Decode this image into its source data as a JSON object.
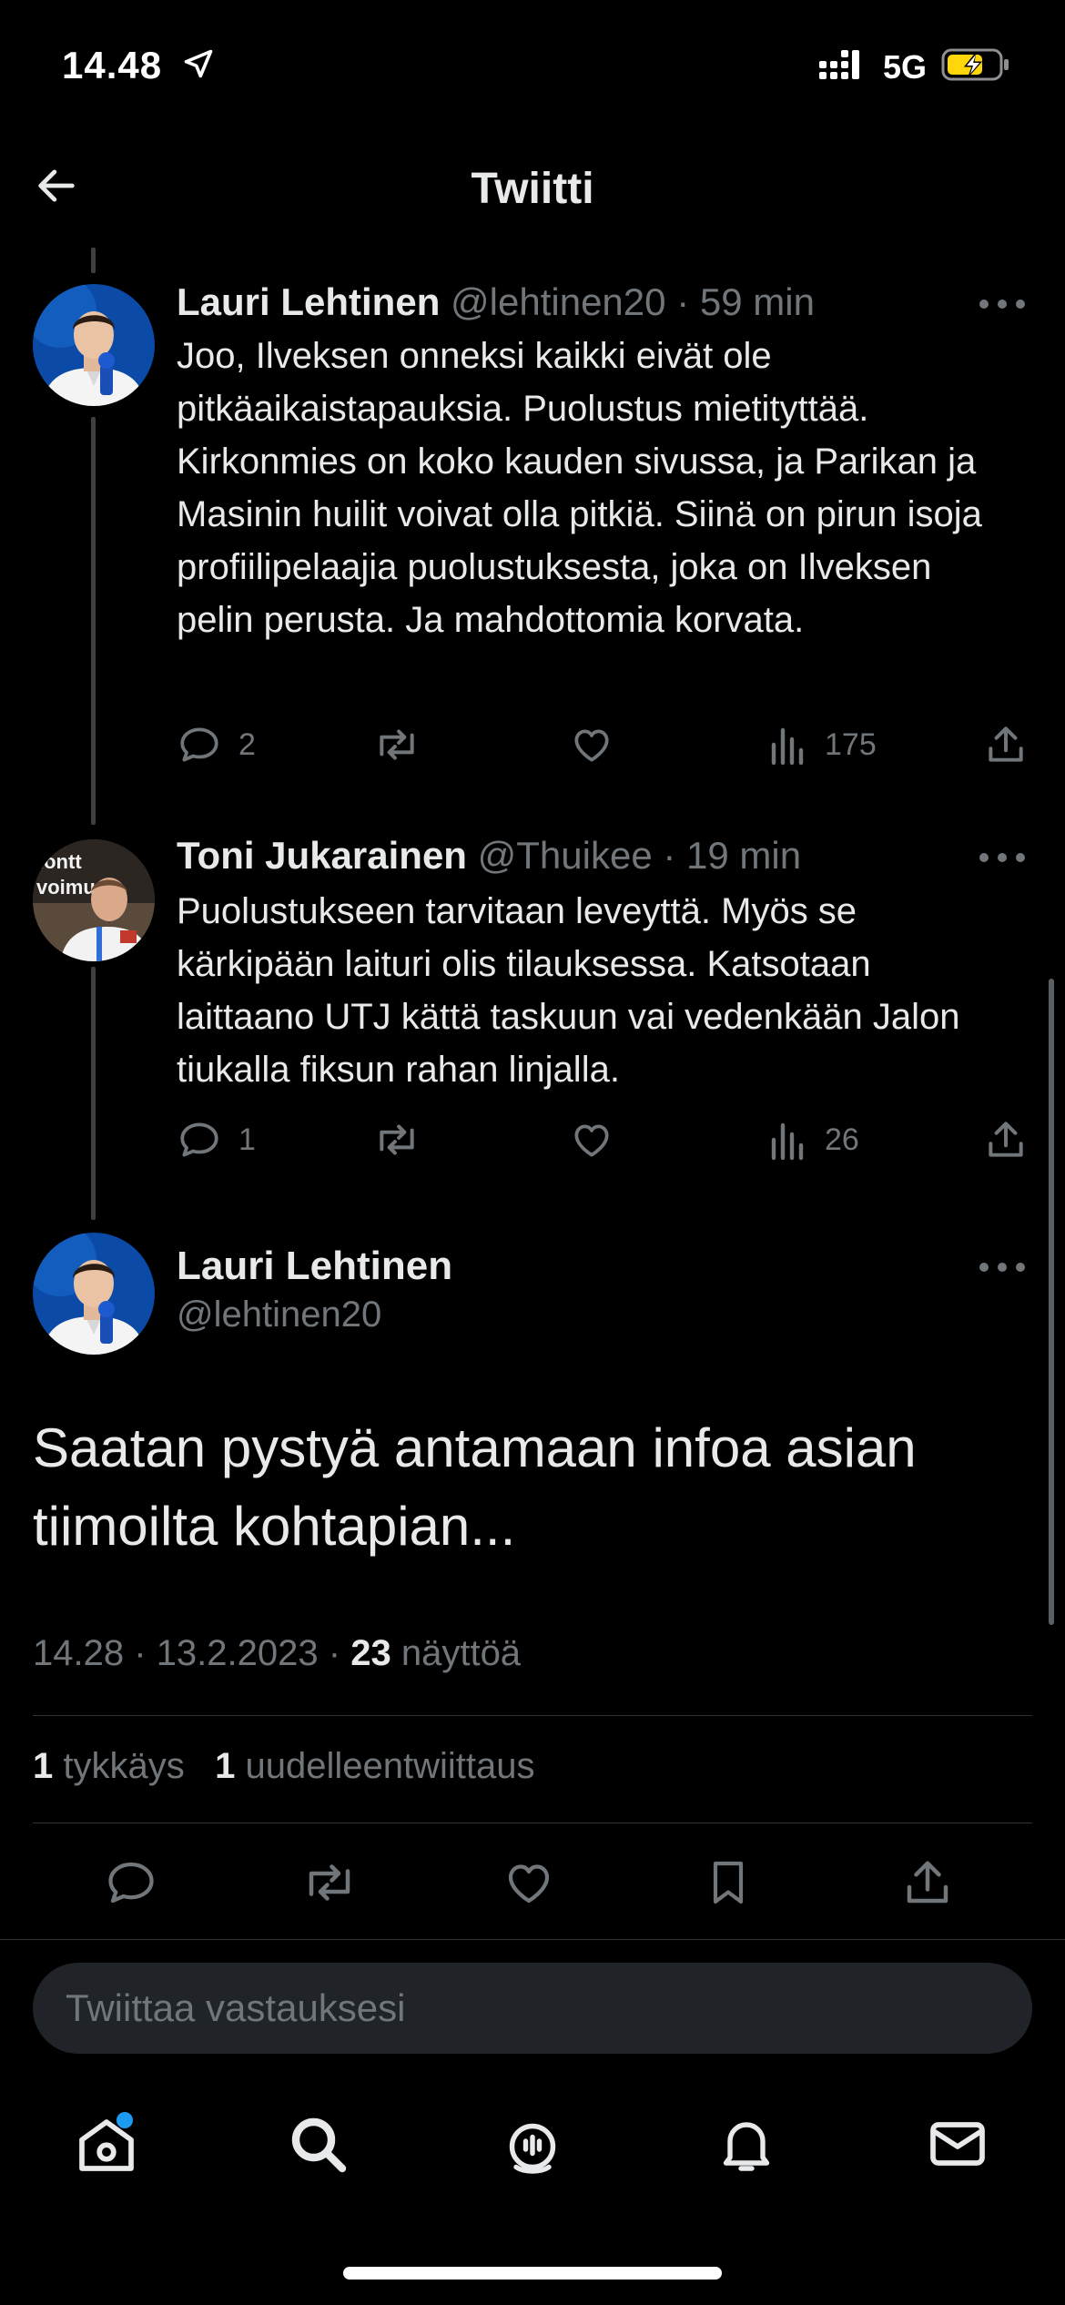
{
  "status_bar": {
    "time": "14.48",
    "network": "5G"
  },
  "nav": {
    "title": "Twiitti"
  },
  "replies": [
    {
      "name": "Lauri Lehtinen",
      "handle": "@lehtinen20",
      "separator": "·",
      "time": "59 min",
      "text": "Joo, Ilveksen onneksi kaikki eivät ole pitkäaikaistapauksia. Puolustus mietityttää. Kirkonmies on koko kauden sivussa, ja Parikan ja Masinin huilit voivat olla pitkiä. Siinä on pirun isoja profiilipelaajia puolustuksesta, joka on Ilveksen pelin perusta. Ja mahdottomia korvata.",
      "reply_count": "2",
      "views": "175"
    },
    {
      "name": "Toni Jukarainen",
      "handle": "@Thuikee",
      "separator": "·",
      "time": "19 min",
      "text": "Puolustukseen tarvitaan leveyttä. Myös se kärkipään laituri olis tilauksessa. Katsotaan laittaano UTJ kättä taskuun vai vedenkään Jalon tiukalla fiksun rahan linjalla.",
      "reply_count": "1",
      "views": "26"
    }
  ],
  "main_tweet": {
    "name": "Lauri Lehtinen",
    "handle": "@lehtinen20",
    "text": "Saatan pystyä antamaan infoa asian tiimoilta kohtapian...",
    "time": "14.28",
    "date": "13.2.2023",
    "separator": "·",
    "views_count": "23",
    "views_label": "näyttöä",
    "likes_count": "1",
    "likes_label": "tykkäys",
    "retweets_count": "1",
    "retweets_label": "uudelleentwiittaus"
  },
  "reply_box": {
    "placeholder": "Twiittaa vastauksesi"
  },
  "colors": {
    "background": "#000000",
    "text": "#e7e9ea",
    "muted": "#71767b",
    "accent": "#1d9bf0"
  },
  "tabbar": {
    "icons": [
      "home-icon",
      "search-icon",
      "spaces-icon",
      "notifications-icon",
      "messages-icon"
    ]
  }
}
